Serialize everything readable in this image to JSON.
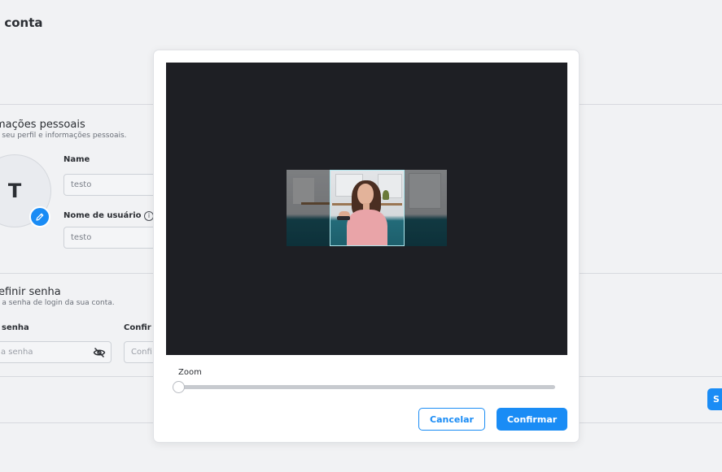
{
  "page": {
    "title": "a conta"
  },
  "personal_info": {
    "title": "mações pessoais",
    "subtitle": "e seu perfil e informações pessoais.",
    "avatar_initial": "T",
    "name_label": "Name",
    "name_value": "testo",
    "username_label": "Nome de usuário",
    "username_value": "testo"
  },
  "password": {
    "title": "efinir senha",
    "subtitle": "e a senha de login da sua conta.",
    "current_label": "senha",
    "current_placeholder": "a senha",
    "confirm_label": "Confir",
    "confirm_placeholder": "Confi"
  },
  "save_button_label": "S",
  "modal": {
    "zoom_label": "Zoom",
    "zoom_value": 0,
    "cancel_label": "Cancelar",
    "confirm_label": "Confirmar"
  },
  "colors": {
    "accent": "#1a8cf5",
    "background": "#f1f2f4",
    "crop_background": "#1e1f24",
    "crop_border": "#aee7ee"
  },
  "icons": {
    "avatar_edit": "pencil-icon",
    "username_info": "info-icon",
    "password_visibility": "eye-off-icon"
  }
}
